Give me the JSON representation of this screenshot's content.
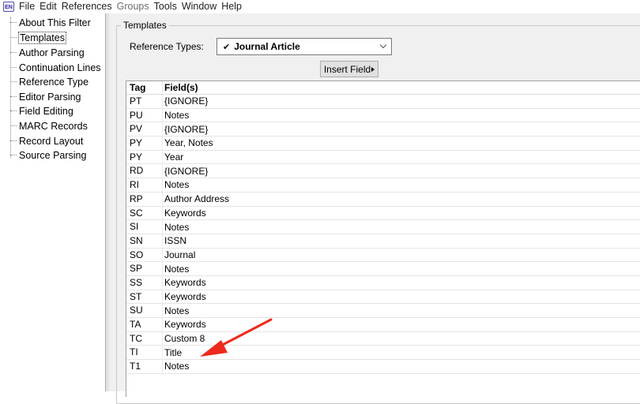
{
  "menu": [
    {
      "label": "File",
      "disabled": false
    },
    {
      "label": "Edit",
      "disabled": false
    },
    {
      "label": "References",
      "disabled": false
    },
    {
      "label": "Groups",
      "disabled": true
    },
    {
      "label": "Tools",
      "disabled": false
    },
    {
      "label": "Window",
      "disabled": false
    },
    {
      "label": "Help",
      "disabled": false
    }
  ],
  "app_icon": "EN",
  "sidebar": {
    "items": [
      {
        "label": "About This Filter"
      },
      {
        "label": "Templates",
        "selected": true
      },
      {
        "label": "Author Parsing"
      },
      {
        "label": "Continuation Lines"
      },
      {
        "label": "Reference Type"
      },
      {
        "label": "Editor Parsing"
      },
      {
        "label": "Field Editing"
      },
      {
        "label": "MARC Records"
      },
      {
        "label": "Record Layout"
      },
      {
        "label": "Source Parsing"
      }
    ]
  },
  "main": {
    "group_title": "Templates",
    "reftype_label": "Reference Types:",
    "reftype_value": "Journal Article",
    "insert_button": "Insert Field",
    "table": {
      "headers": {
        "tag": "Tag",
        "field": "Field(s)"
      },
      "rows": [
        {
          "tag": "PT",
          "field": "{IGNORE}"
        },
        {
          "tag": "PU",
          "field": "Notes"
        },
        {
          "tag": "PV",
          "field": "{IGNORE}"
        },
        {
          "tag": "PY",
          "field": "Year, Notes"
        },
        {
          "tag": "PY",
          "field": "Year"
        },
        {
          "tag": "RD",
          "field": "{IGNORE}"
        },
        {
          "tag": "RI",
          "field": "Notes"
        },
        {
          "tag": "RP",
          "field": "Author Address"
        },
        {
          "tag": "SC",
          "field": "Keywords"
        },
        {
          "tag": "SI",
          "field": "Notes"
        },
        {
          "tag": "SN",
          "field": "ISSN"
        },
        {
          "tag": "SO",
          "field": "Journal"
        },
        {
          "tag": "SP",
          "field": "Notes"
        },
        {
          "tag": "SS",
          "field": "Keywords"
        },
        {
          "tag": "ST",
          "field": "Keywords"
        },
        {
          "tag": "SU",
          "field": "Notes"
        },
        {
          "tag": "TA",
          "field": "Keywords"
        },
        {
          "tag": "TC",
          "field": "Custom 8"
        },
        {
          "tag": "TI",
          "field": "Title"
        },
        {
          "tag": "T1",
          "field": "Notes"
        }
      ]
    }
  },
  "annotation": {
    "type": "red-arrow",
    "color": "#ee2a1c",
    "points_to_tag": "TC"
  }
}
